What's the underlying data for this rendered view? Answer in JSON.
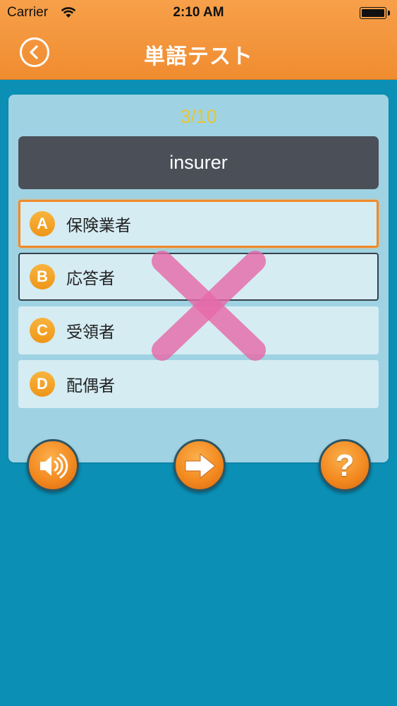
{
  "status_bar": {
    "carrier": "Carrier",
    "time": "2:10 AM",
    "wifi_icon": "wifi-icon",
    "battery_icon": "battery-icon"
  },
  "header": {
    "title": "単語テスト",
    "back_icon": "chevron-left-icon",
    "color": "#f29336"
  },
  "quiz": {
    "progress": "3/10",
    "word": "insurer",
    "options": [
      {
        "letter": "A",
        "label": "保険業者",
        "state": "selected"
      },
      {
        "letter": "B",
        "label": "応答者",
        "state": "pressed"
      },
      {
        "letter": "C",
        "label": "受領者",
        "state": "normal"
      },
      {
        "letter": "D",
        "label": "配偶者",
        "state": "normal"
      }
    ],
    "result_mark": "wrong-x-icon",
    "result_color": "#e56aa8"
  },
  "controls": {
    "sound_icon": "speaker-icon",
    "next_icon": "arrow-right-icon",
    "help_label": "?"
  },
  "colors": {
    "background": "#0b8fb5",
    "card": "#9fd3e3",
    "accent": "#f08a2a",
    "progress_text": "#e6c53a"
  }
}
